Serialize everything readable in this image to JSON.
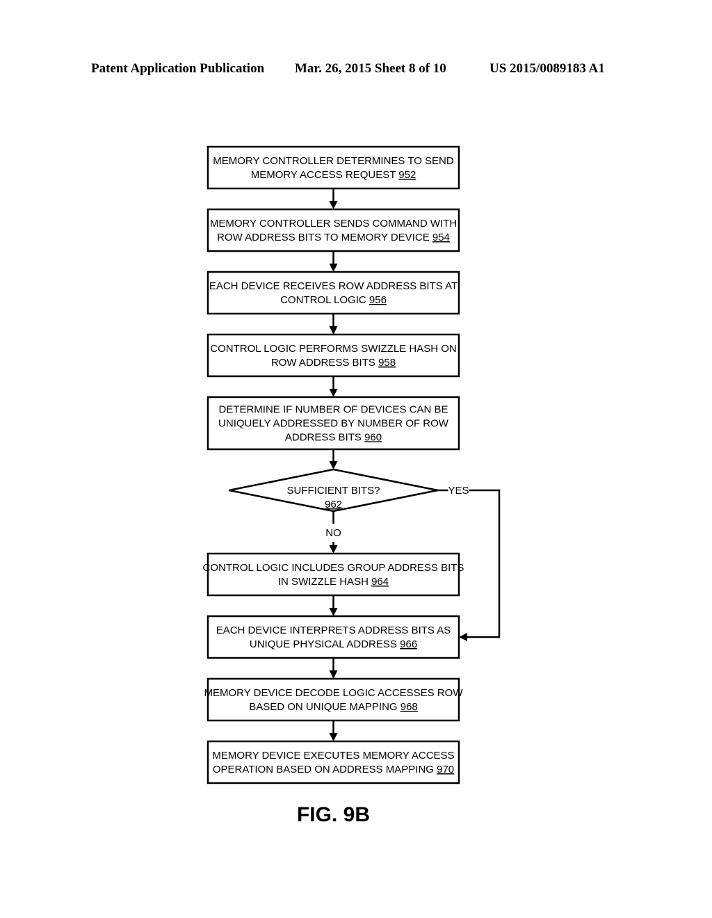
{
  "header": {
    "left": "Patent Application Publication",
    "middle": "Mar. 26, 2015  Sheet 8 of 10",
    "right": "US 2015/0089183 A1"
  },
  "flowchart": {
    "nodes": [
      {
        "id": "952",
        "type": "process",
        "lines": [
          "MEMORY CONTROLLER DETERMINES TO SEND",
          "MEMORY ACCESS REQUEST"
        ],
        "ref": "952"
      },
      {
        "id": "954",
        "type": "process",
        "lines": [
          "MEMORY CONTROLLER SENDS COMMAND WITH",
          "ROW ADDRESS BITS TO MEMORY DEVICE"
        ],
        "ref": "954"
      },
      {
        "id": "956",
        "type": "process",
        "lines": [
          "EACH DEVICE RECEIVES ROW ADDRESS BITS AT",
          "CONTROL LOGIC"
        ],
        "ref": "956"
      },
      {
        "id": "958",
        "type": "process",
        "lines": [
          "CONTROL LOGIC PERFORMS SWIZZLE HASH ON",
          "ROW ADDRESS BITS"
        ],
        "ref": "958"
      },
      {
        "id": "960",
        "type": "process",
        "lines": [
          "DETERMINE IF NUMBER OF DEVICES CAN BE",
          "UNIQUELY ADDRESSED BY NUMBER OF ROW",
          "ADDRESS BITS"
        ],
        "ref": "960"
      },
      {
        "id": "962",
        "type": "decision",
        "lines": [
          "SUFFICIENT BITS?"
        ],
        "ref": "962"
      },
      {
        "id": "964",
        "type": "process",
        "lines": [
          "CONTROL LOGIC INCLUDES GROUP ADDRESS BITS",
          "IN SWIZZLE HASH"
        ],
        "ref": "964"
      },
      {
        "id": "966",
        "type": "process",
        "lines": [
          "EACH DEVICE INTERPRETS ADDRESS BITS AS",
          "UNIQUE PHYSICAL ADDRESS"
        ],
        "ref": "966"
      },
      {
        "id": "968",
        "type": "process",
        "lines": [
          "MEMORY DEVICE DECODE LOGIC ACCESSES ROW",
          "BASED ON UNIQUE MAPPING"
        ],
        "ref": "968"
      },
      {
        "id": "970",
        "type": "process",
        "lines": [
          "MEMORY DEVICE EXECUTES MEMORY ACCESS",
          "OPERATION BASED ON ADDRESS MAPPING"
        ],
        "ref": "970"
      }
    ],
    "edges": [
      {
        "from": "952",
        "to": "954",
        "label": ""
      },
      {
        "from": "954",
        "to": "956",
        "label": ""
      },
      {
        "from": "956",
        "to": "958",
        "label": ""
      },
      {
        "from": "958",
        "to": "960",
        "label": ""
      },
      {
        "from": "960",
        "to": "962",
        "label": ""
      },
      {
        "from": "962",
        "to": "964",
        "label": "NO"
      },
      {
        "from": "962",
        "to": "966",
        "label": "YES"
      },
      {
        "from": "964",
        "to": "966",
        "label": ""
      },
      {
        "from": "966",
        "to": "968",
        "label": ""
      },
      {
        "from": "968",
        "to": "970",
        "label": ""
      }
    ]
  },
  "figure_label": "FIG. 9B"
}
